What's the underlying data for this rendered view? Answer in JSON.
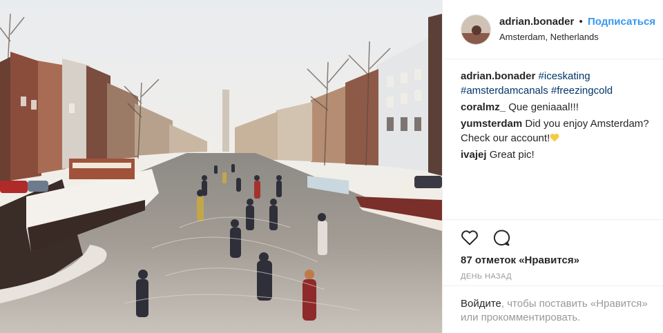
{
  "post": {
    "username": "adrian.bonader",
    "separator": "•",
    "follow_label": "Подписаться",
    "location": "Amsterdam, Netherlands"
  },
  "caption": {
    "username": "adrian.bonader",
    "tags": [
      "#iceskating",
      "#amsterdamcanals",
      "#freezingcold"
    ]
  },
  "comments": [
    {
      "user": "coralmz_",
      "text": "Que geniaaal!!!"
    },
    {
      "user": "yumsterdam",
      "text": "Did you enjoy Amsterdam? Check our account!"
    },
    {
      "user": "ivajej",
      "text": "Great pic!"
    }
  ],
  "actions": {
    "like_icon": "heart-outline-icon",
    "comment_icon": "speech-bubble-icon",
    "likes_text": "87 отметок «Нравится»",
    "time_text": "ДЕНЬ НАЗАД"
  },
  "login_prompt": {
    "link": "Войдите",
    "text": ", чтобы поставить «Нравится» или прокомментировать."
  },
  "colors": {
    "link_blue": "#3897f0",
    "hashtag": "#003569",
    "muted": "#999999"
  }
}
